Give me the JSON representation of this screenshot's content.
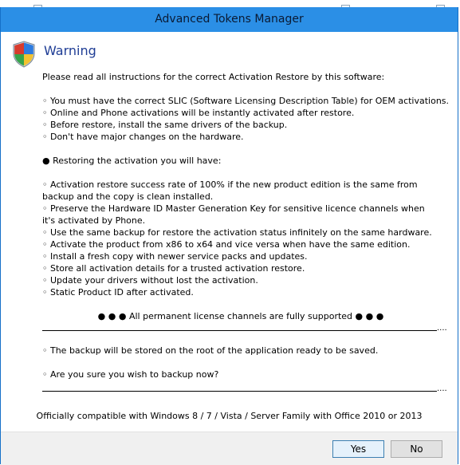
{
  "window": {
    "title": "Advanced Tokens Manager"
  },
  "dialog": {
    "heading": "Warning",
    "intro": "Please read all instructions for the correct Activation Restore by this software:",
    "requirements": [
      "◦ You must have the correct SLIC (Software Licensing Description Table) for OEM activations.",
      "◦ Online and Phone activations will be instantly activated after restore.",
      "◦ Before restore, install the same drivers of the backup.",
      "◦ Don't have major changes on the hardware."
    ],
    "restoring_heading": "● Restoring the activation you will have:",
    "benefits": [
      "◦ Activation restore success rate of 100% if the new product edition is the same from backup and the copy is clean installed.",
      "◦ Preserve the Hardware ID Master Generation Key for sensitive licence channels when it's activated by Phone.",
      "◦ Use the same backup for restore the activation status infinitely on the same hardware.",
      "◦ Activate the product from x86 to x64 and vice versa when have the same edition.",
      "◦ Install a fresh copy with newer service packs and updates.",
      "◦ Store all activation details for a trusted activation restore.",
      "◦ Update your drivers without lost the activation.",
      "◦ Static Product ID after activated."
    ],
    "channels_note": "● ● ● All permanent license channels are fully supported ● ● ●",
    "separator_dots": "....",
    "backup_note": "◦ The backup will be stored on the root of the application ready to be saved.",
    "question": "◦ Are you sure you wish to backup now?",
    "compatibility": "Officially compatible with Windows 8 / 7 / Vista / Server Family with Office 2010 or 2013"
  },
  "buttons": {
    "yes": "Yes",
    "no": "No"
  },
  "colors": {
    "titlebar": "#2b8fe6",
    "heading": "#1f3d95",
    "button_bar": "#f0f0f0"
  },
  "icons": {
    "header": "shield-icon"
  }
}
